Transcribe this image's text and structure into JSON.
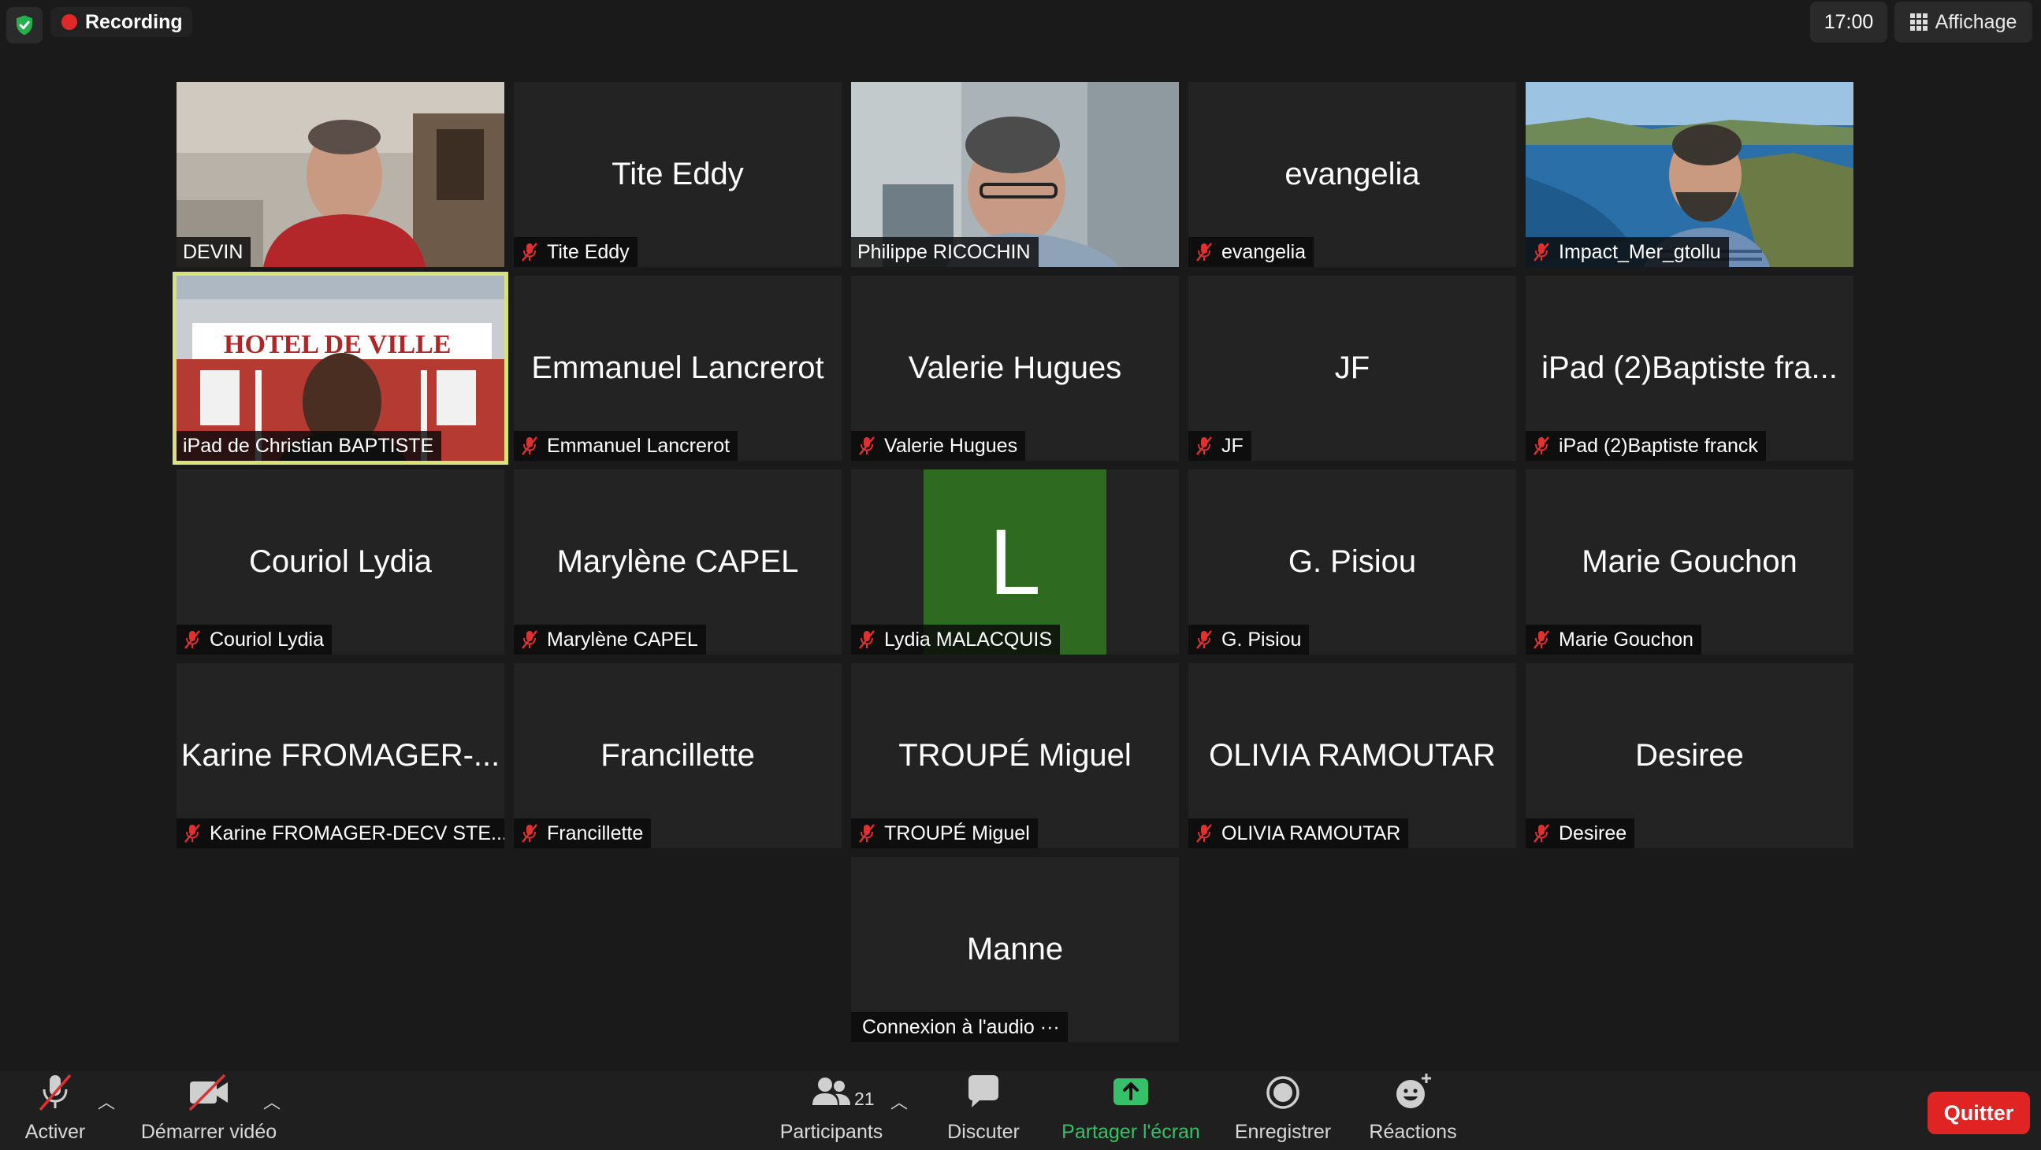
{
  "topbar": {
    "recording_label": "Recording",
    "clock": "17:00",
    "view_label": "Affichage"
  },
  "tiles": [
    {
      "name": "DEVIN",
      "label": "DEVIN",
      "video": true,
      "muted": false
    },
    {
      "name": "Tite Eddy",
      "label": "Tite Eddy",
      "video": false,
      "muted": true
    },
    {
      "name": "Philippe RICOCHIN",
      "label": "Philippe RICOCHIN",
      "video": true,
      "muted": false
    },
    {
      "name": "evangelia",
      "label": "evangelia",
      "video": false,
      "muted": true
    },
    {
      "name": "Impact_Mer_gtollu",
      "label": "Impact_Mer_gtollu",
      "video": true,
      "muted": true
    },
    {
      "name": "iPad de Christian BAPTISTE",
      "label": "iPad de Christian BAPTISTE",
      "video": true,
      "muted": false,
      "active_speaker": true
    },
    {
      "name": "Emmanuel Lancrerot",
      "label": "Emmanuel Lancrerot",
      "video": false,
      "muted": true
    },
    {
      "name": "Valerie Hugues",
      "label": "Valerie Hugues",
      "video": false,
      "muted": true
    },
    {
      "name": "JF",
      "label": "JF",
      "video": false,
      "muted": true
    },
    {
      "name": "iPad (2)Baptiste fra...",
      "label": "iPad (2)Baptiste franck",
      "video": false,
      "muted": true
    },
    {
      "name": "Couriol Lydia",
      "label": "Couriol Lydia",
      "video": false,
      "muted": true
    },
    {
      "name": "Marylène CAPEL",
      "label": "Marylène CAPEL",
      "video": false,
      "muted": true
    },
    {
      "name": "L",
      "label": "Lydia MALACQUIS",
      "video": false,
      "muted": true,
      "avatar_letter": "L",
      "avatar_color": "#2e6a1f"
    },
    {
      "name": "G. Pisiou",
      "label": "G. Pisiou",
      "video": false,
      "muted": true
    },
    {
      "name": "Marie Gouchon",
      "label": "Marie Gouchon",
      "video": false,
      "muted": true
    },
    {
      "name": "Karine FROMAGER-...",
      "label": "Karine FROMAGER-DECV STE...",
      "video": false,
      "muted": true
    },
    {
      "name": "Francillette",
      "label": "Francillette",
      "video": false,
      "muted": true
    },
    {
      "name": "TROUPÉ Miguel",
      "label": "TROUPÉ Miguel",
      "video": false,
      "muted": true
    },
    {
      "name": "OLIVIA RAMOUTAR",
      "label": "OLIVIA RAMOUTAR",
      "video": false,
      "muted": true
    },
    {
      "name": "Desiree",
      "label": "Desiree",
      "video": false,
      "muted": true
    },
    {
      "name": "Manne",
      "label": "Connexion à l'audio ···",
      "video": false,
      "muted": false
    }
  ],
  "toolbar": {
    "unmute_label": "Activer",
    "start_video_label": "Démarrer vidéo",
    "participants_label": "Participants",
    "participants_count": "21",
    "chat_label": "Discuter",
    "share_label": "Partager l'écran",
    "record_label": "Enregistrer",
    "reactions_label": "Réactions",
    "quit_label": "Quitter"
  },
  "colors": {
    "share_green": "#37c06a",
    "quit_red": "#e02323",
    "active_speaker_border": "#d7e37a",
    "muted_red": "#e03030"
  }
}
